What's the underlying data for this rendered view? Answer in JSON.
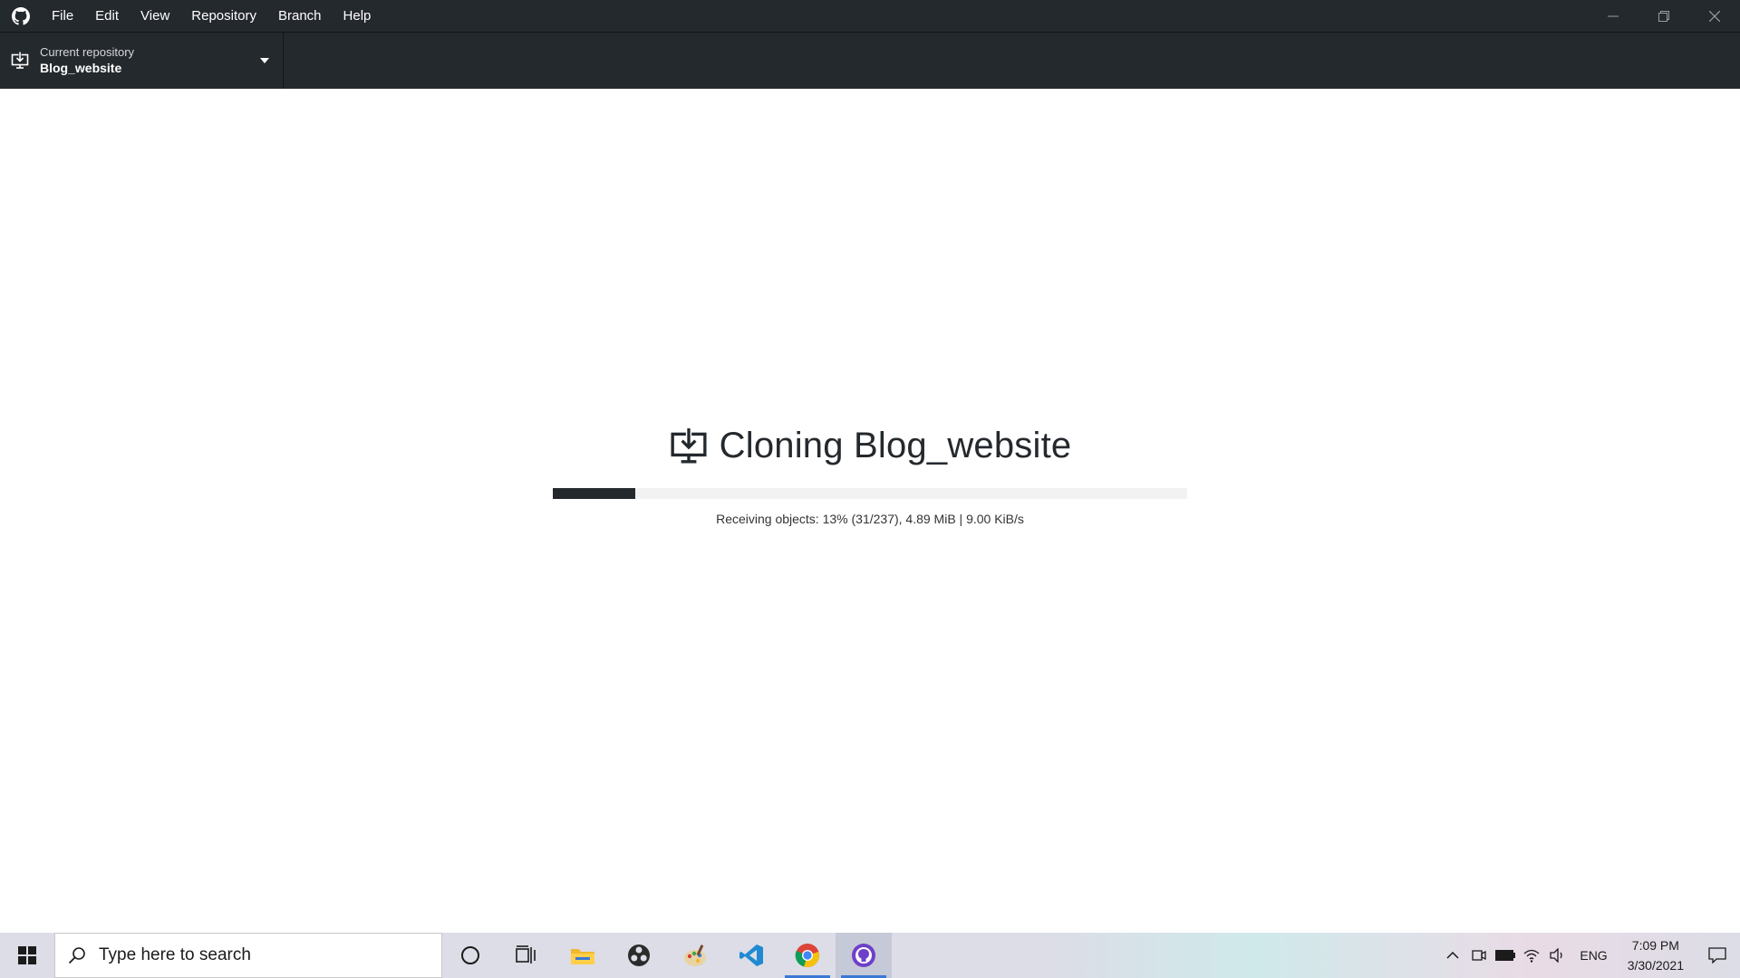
{
  "app": {
    "logo_icon": "github-octocat-icon"
  },
  "menu": {
    "items": [
      {
        "label": "File"
      },
      {
        "label": "Edit"
      },
      {
        "label": "View"
      },
      {
        "label": "Repository"
      },
      {
        "label": "Branch"
      },
      {
        "label": "Help"
      }
    ]
  },
  "window_controls": {
    "minimize_icon": "minimize-icon",
    "restore_icon": "restore-icon",
    "close_icon": "close-icon"
  },
  "toolbar": {
    "repo_caption": "Current repository",
    "repo_name": "Blog_website",
    "repo_icon": "clone-desktop-icon",
    "caret_icon": "chevron-down-icon"
  },
  "clone": {
    "title": "Cloning Blog_website",
    "progress_fraction": 0.13,
    "status": "Receiving objects: 13% (31/237), 4.89 MiB | 9.00 KiB/s"
  },
  "taskbar": {
    "search_placeholder": "Type here to search",
    "apps": [
      {
        "name": "cortana-icon"
      },
      {
        "name": "task-view-icon"
      },
      {
        "name": "file-explorer-icon"
      },
      {
        "name": "obs-studio-icon"
      },
      {
        "name": "paint-icon"
      },
      {
        "name": "vscode-icon"
      },
      {
        "name": "chrome-icon"
      },
      {
        "name": "github-desktop-icon"
      }
    ],
    "tray": {
      "language": "ENG",
      "time": "7:09 PM",
      "date": "3/30/2021"
    }
  },
  "colors": {
    "chrome_dark": "#24292e",
    "progress_track": "#f2f2f2",
    "taskbar_accent": "#3a78d6"
  }
}
